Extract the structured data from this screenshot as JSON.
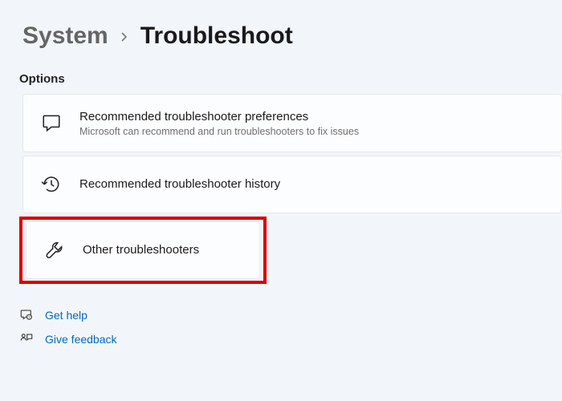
{
  "breadcrumb": {
    "parent": "System",
    "current": "Troubleshoot"
  },
  "section_label": "Options",
  "cards": {
    "prefs": {
      "title": "Recommended troubleshooter preferences",
      "subtitle": "Microsoft can recommend and run troubleshooters to fix issues"
    },
    "history": {
      "title": "Recommended troubleshooter history"
    },
    "other": {
      "title": "Other troubleshooters"
    }
  },
  "links": {
    "help": "Get help",
    "feedback": "Give feedback"
  }
}
